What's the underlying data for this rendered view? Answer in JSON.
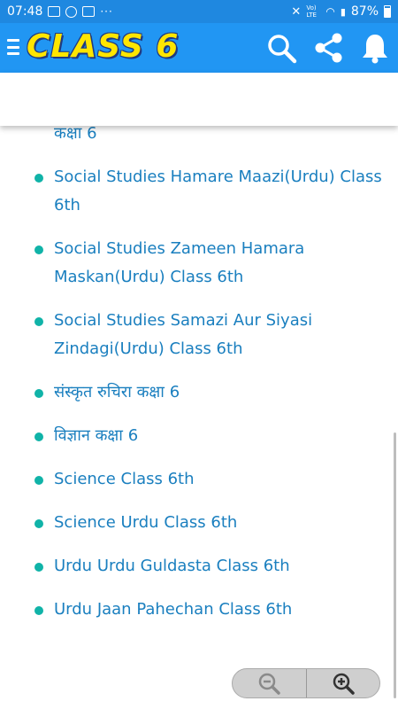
{
  "status_bar": {
    "time": "07:48",
    "dots": "···",
    "network": "Vo) LTE",
    "battery": "87%"
  },
  "app_bar": {
    "title": "CLASS 6",
    "title_color": "#ffe600",
    "bar_color": "#2196f3",
    "icons": [
      "menu-icon",
      "search-icon",
      "share-icon",
      "bell-icon"
    ]
  },
  "list": {
    "bullet_color": "#10b3a8",
    "link_color": "#1a7fbf",
    "items": [
      "कक्षा 6",
      "Social Studies Hamare Maazi(Urdu) Class 6th",
      "Social Studies Zameen Hamara Maskan(Urdu) Class 6th",
      "Social Studies Samazi Aur Siyasi Zindagi(Urdu) Class 6th",
      "संस्कृत रुचिरा कक्षा 6",
      "विज्ञान कक्षा 6",
      "Science Class 6th",
      "Science Urdu Class 6th",
      "Urdu Urdu Guldasta Class 6th",
      "Urdu Jaan Pahechan Class 6th"
    ]
  },
  "zoom_control": {
    "icons": [
      "zoom-out-icon",
      "zoom-in-icon"
    ]
  }
}
